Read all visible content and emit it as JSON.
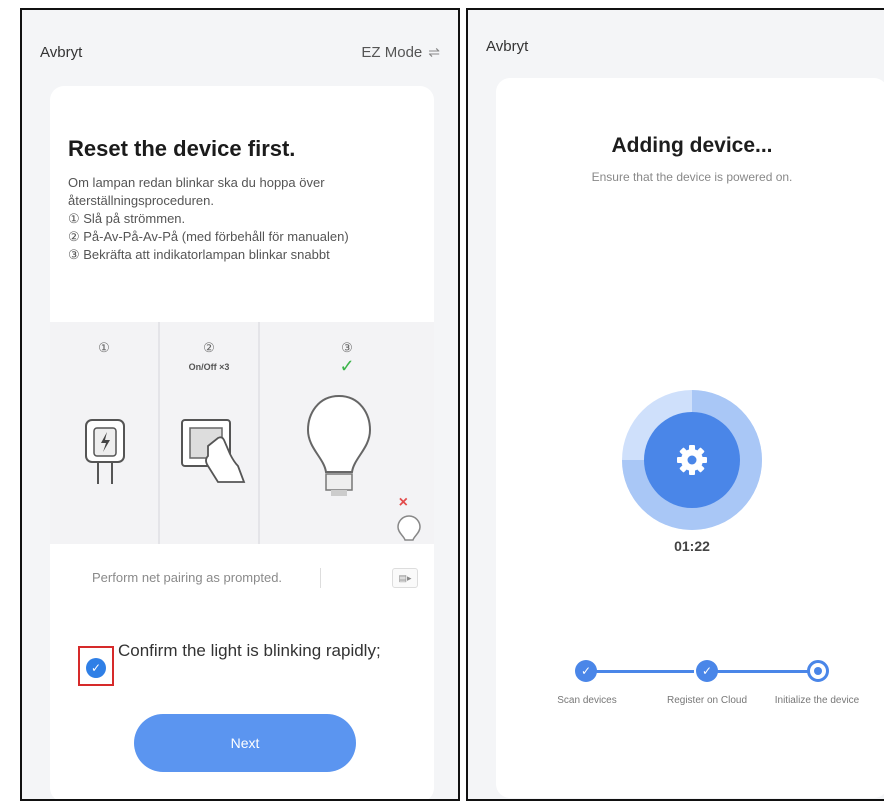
{
  "left_screen": {
    "cancel_label": "Avbryt",
    "mode_label": "EZ Mode",
    "mode_icon": "swap-icon",
    "title": "Reset the device first.",
    "instructions": [
      "Om lampan redan blinkar ska du hoppa över återställningsproceduren.",
      "① Slå på strömmen.",
      "② På-Av-På-Av-På (med förbehåll för manualen)",
      "③ Bekräfta att indikatorlampan blinkar snabbt"
    ],
    "illustration": {
      "step1": "①",
      "step2": "②",
      "step2_caption": "On/Off ×3",
      "step3": "③",
      "check_mark": "✓",
      "cross_mark": "×"
    },
    "prompt_text": "Perform net pairing as prompted.",
    "prompt_button": "▤▸",
    "confirm_label": "Confirm the light is blinking rapidly;",
    "confirm_checked": true,
    "next_label": "Next"
  },
  "right_screen": {
    "cancel_label": "Avbryt",
    "title": "Adding device...",
    "subtitle": "Ensure that the device is powered on.",
    "progress_fraction": 0.75,
    "center_icon": "gear-icon",
    "timer": "01:22",
    "steps": [
      {
        "label": "Scan devices",
        "state": "done"
      },
      {
        "label": "Register on Cloud",
        "state": "done"
      },
      {
        "label": "Initialize the device",
        "state": "current"
      }
    ]
  },
  "colors": {
    "accent": "#4a86e8",
    "button": "#5b95f0",
    "highlight_box": "#d62a2a",
    "success": "#3bb44a",
    "error": "#e24b4b"
  }
}
